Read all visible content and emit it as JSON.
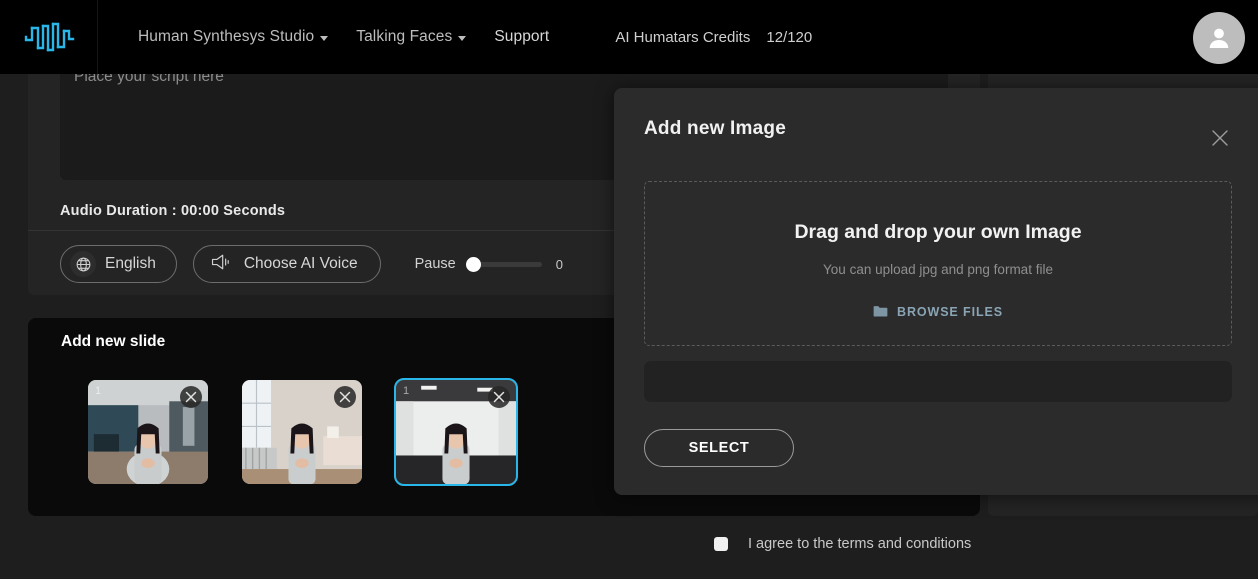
{
  "nav": {
    "logo_name": "audio-waveform-logo",
    "items": [
      {
        "label": "Human Synthesys Studio",
        "has_caret": true
      },
      {
        "label": "Talking Faces",
        "has_caret": true
      },
      {
        "label": "Support",
        "has_caret": false
      }
    ],
    "credits_label": "AI Humatars Credits",
    "credits_value": "12/120",
    "avatar_name": "user-avatar"
  },
  "editor": {
    "script_placeholder": "Place your script here",
    "script_value": "",
    "audio_duration": "Audio Duration : 00:00 Seconds",
    "language_button": "English",
    "voice_button": "Choose AI Voice",
    "pause_label": "Pause",
    "pause_value": "0",
    "pause_percent": 0
  },
  "slides": {
    "title": "Add new slide",
    "items": [
      {
        "badge": "1",
        "selected": false,
        "scene": "corridor"
      },
      {
        "badge": "",
        "selected": false,
        "scene": "bedroom"
      },
      {
        "badge": "1",
        "selected": true,
        "scene": "white-room"
      }
    ]
  },
  "terms": {
    "label": "I agree to the terms and conditions",
    "checked": false
  },
  "modal": {
    "title": "Add new Image",
    "dropzone_title": "Drag and drop your own Image",
    "dropzone_subtitle": "You can upload jpg and png format file",
    "browse_label": "BROWSE FILES",
    "input_value": "",
    "select_label": "SELECT"
  },
  "colors": {
    "accent": "#29b6e8",
    "modal_bg": "#2b2b2b",
    "page_bg": "#1e1e1e",
    "nav_bg": "#000000",
    "browse_text": "#8aa4b4"
  }
}
